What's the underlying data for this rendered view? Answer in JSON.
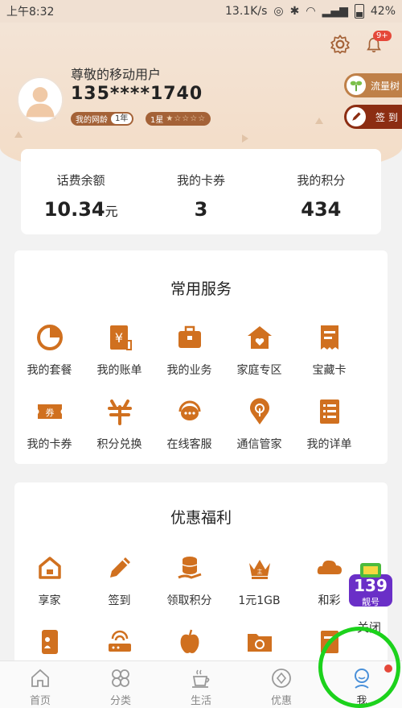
{
  "status_bar": {
    "time": "上午8:32",
    "speed": "13.1K/s",
    "battery": "42%"
  },
  "header": {
    "notification_badge": "9+",
    "user_greeting": "尊敬的移动用户",
    "phone_masked": "135****1740",
    "network_age_label": "我的网龄",
    "network_age_value": "1年",
    "star_level_label": "1星",
    "star_rating": "★☆☆☆☆",
    "side_buttons": [
      {
        "label": "流量树",
        "icon": "sprout-icon"
      },
      {
        "label": "签 到",
        "icon": "pencil-icon"
      }
    ]
  },
  "balance": [
    {
      "label": "话费余额",
      "value": "10.34",
      "unit": "元"
    },
    {
      "label": "我的卡券",
      "value": "3",
      "unit": ""
    },
    {
      "label": "我的积分",
      "value": "434",
      "unit": ""
    }
  ],
  "common_services": {
    "title": "常用服务",
    "items": [
      {
        "label": "我的套餐",
        "icon": "pie-chart-icon"
      },
      {
        "label": "我的账单",
        "icon": "bill-icon"
      },
      {
        "label": "我的业务",
        "icon": "briefcase-icon"
      },
      {
        "label": "家庭专区",
        "icon": "home-heart-icon"
      },
      {
        "label": "宝藏卡",
        "icon": "receipt-card-icon"
      },
      {
        "label": "我的卡券",
        "icon": "coupon-icon"
      },
      {
        "label": "积分兑换",
        "icon": "exchange-icon"
      },
      {
        "label": "在线客服",
        "icon": "chat-headset-icon"
      },
      {
        "label": "通信管家",
        "icon": "signal-pin-icon"
      },
      {
        "label": "我的详单",
        "icon": "list-detail-icon"
      }
    ]
  },
  "benefits": {
    "title": "优惠福利",
    "items": [
      {
        "label": "享家",
        "icon": "house-icon"
      },
      {
        "label": "签到",
        "icon": "pencil-icon"
      },
      {
        "label": "领取积分",
        "icon": "coin-stack-icon"
      },
      {
        "label": "1元1GB",
        "icon": "crown-icon"
      },
      {
        "label": "和彩",
        "icon": "cloud-icon"
      }
    ],
    "row2_icons": [
      "phone-app-icon",
      "router-icon",
      "apple-icon",
      "folder-icon",
      "document-icon"
    ]
  },
  "promo": {
    "text": "139",
    "subtext": "靓号",
    "close_label": "关闭"
  },
  "tabbar": [
    {
      "label": "首页",
      "icon": "home-tab-icon"
    },
    {
      "label": "分类",
      "icon": "category-tab-icon"
    },
    {
      "label": "生活",
      "icon": "coffee-tab-icon"
    },
    {
      "label": "优惠",
      "icon": "coupon-tab-icon"
    },
    {
      "label": "我",
      "icon": "profile-tab-icon"
    }
  ],
  "colors": {
    "accent": "#d0701f",
    "brown": "#a46237",
    "sign_red": "#8c2d12",
    "annotation_green": "#1cd21c"
  }
}
